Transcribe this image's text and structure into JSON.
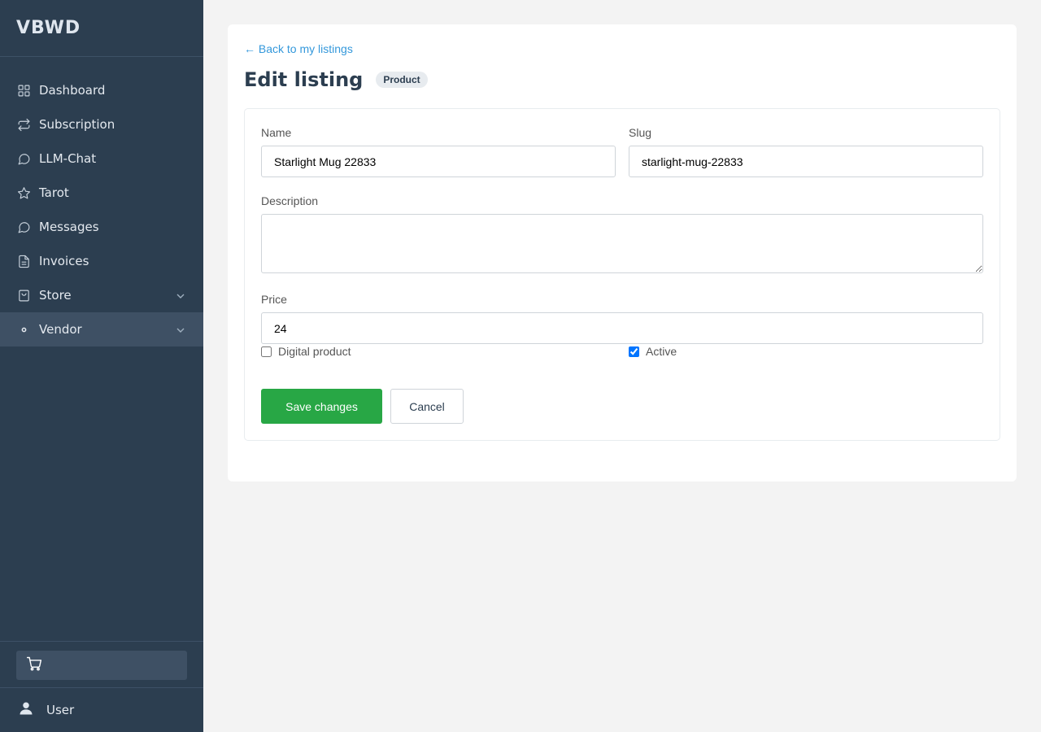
{
  "app": {
    "brand": "VBWD"
  },
  "sidebar": {
    "items": [
      {
        "label": "Dashboard",
        "icon": "dashboard-icon"
      },
      {
        "label": "Subscription",
        "icon": "repeat-icon"
      },
      {
        "label": "LLM-Chat",
        "icon": "chat-bubble-icon"
      },
      {
        "label": "Tarot",
        "icon": "star-icon"
      },
      {
        "label": "Messages",
        "icon": "chat-bubble-icon"
      },
      {
        "label": "Invoices",
        "icon": "document-icon"
      },
      {
        "label": "Store",
        "icon": "bag-icon",
        "expandable": true
      },
      {
        "label": "Vendor",
        "icon": "dot-icon",
        "expandable": true,
        "active": true
      }
    ],
    "cart_icon": "cart-icon",
    "user_label": "User"
  },
  "main": {
    "back_link": "← Back to my listings",
    "title": "Edit listing",
    "badge": "Product",
    "form": {
      "name_label": "Name",
      "name_value": "Starlight Mug 22833",
      "slug_label": "Slug",
      "slug_value": "starlight-mug-22833",
      "description_label": "Description",
      "description_value": "",
      "price_label": "Price",
      "price_value": "24",
      "digital_label": "Digital product",
      "digital_checked": false,
      "active_label": "Active",
      "active_checked": true,
      "save_label": "Save changes",
      "cancel_label": "Cancel"
    }
  },
  "colors": {
    "sidebar_bg": "#2c3e50",
    "active_item_bg": "#3e5064",
    "link": "#3498db",
    "save_button": "#28a745"
  }
}
